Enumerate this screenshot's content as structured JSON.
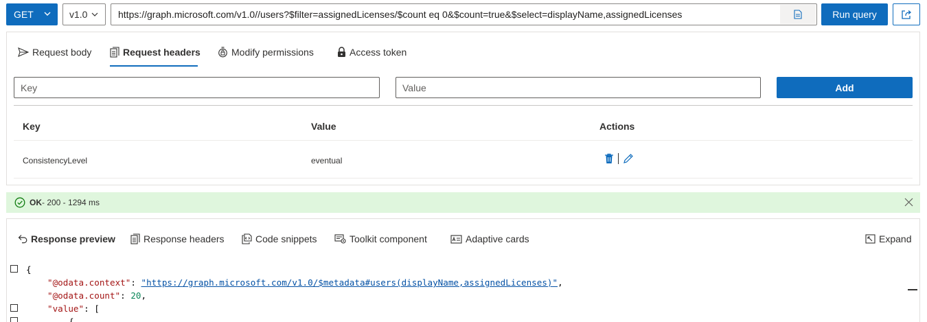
{
  "query_bar": {
    "method": "GET",
    "version": "v1.0",
    "url": "https://graph.microsoft.com/v1.0//users?$filter=assignedLicenses/$count eq 0&$count=true&$select=displayName,assignedLicenses",
    "run_label": "Run query"
  },
  "request": {
    "tabs": [
      {
        "label": "Request body",
        "icon": "send-icon"
      },
      {
        "label": "Request headers",
        "icon": "document-header-icon",
        "active": true
      },
      {
        "label": "Modify permissions",
        "icon": "shield-lock-icon"
      },
      {
        "label": "Access token",
        "icon": "lock-icon"
      }
    ],
    "key_placeholder": "Key",
    "value_placeholder": "Value",
    "add_label": "Add",
    "columns": [
      "Key",
      "Value",
      "Actions"
    ],
    "rows": [
      {
        "key": "ConsistencyLevel",
        "value": "eventual"
      }
    ]
  },
  "status": {
    "ok": "OK",
    "detail": " - 200 - 1294 ms"
  },
  "response": {
    "tabs": [
      {
        "label": "Response preview",
        "icon": "undo-arrow-icon",
        "active": true
      },
      {
        "label": "Response headers",
        "icon": "document-header-icon"
      },
      {
        "label": "Code snippets",
        "icon": "code-snippet-icon"
      },
      {
        "label": "Toolkit component",
        "icon": "toolkit-icon"
      },
      {
        "label": "Adaptive cards",
        "icon": "card-icon"
      }
    ],
    "expand_label": "Expand",
    "code": {
      "open_brace": "{",
      "context_key": "\"@odata.context\"",
      "context_value": "\"https://graph.microsoft.com/v1.0/$metadata#users(displayName,assignedLicenses)\"",
      "count_key": "\"@odata.count\"",
      "count_value": "20",
      "value_key": "\"value\"",
      "value_open": "[",
      "obj_open": "{"
    }
  },
  "colors": {
    "accent": "#0f6cbd",
    "success_bg": "#dff6dd",
    "success_icon": "#107c10"
  }
}
